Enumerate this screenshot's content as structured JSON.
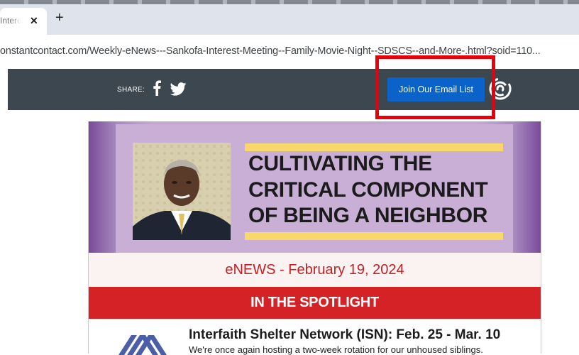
{
  "browser": {
    "tab_title": "Interes",
    "tab_close": "✕",
    "new_tab": "+",
    "url": "onstantcontact.com/Weekly-eNews---Sankofa-Interest-Meeting--Family-Movie-Night--SDSCS--and-More-.html?soid=110..."
  },
  "share_bar": {
    "share_label": "SHARE:",
    "icons": [
      "facebook-icon",
      "twitter-icon"
    ],
    "join_button_label": "Join Our Email List",
    "logo": "constant-contact-logo",
    "colors": {
      "bar": "#3d4750",
      "button": "#0b63c9",
      "highlight": "#e8000b"
    }
  },
  "newsletter": {
    "hero": {
      "line1": "CULTIVATING THE",
      "line2": "CRITICAL COMPONENT",
      "line3": "OF BEING A NEIGHBOR"
    },
    "enews_date": "eNEWS - February 19, 2024",
    "spotlight": "IN THE SPOTLIGHT",
    "item": {
      "title": "Interfaith Shelter Network (ISN): Feb. 25 - Mar. 10",
      "description": "We're once again hosting a two-week rotation for our unhoused siblings."
    },
    "colors": {
      "accent": "#d52226",
      "hero_bg": "#c3a7cf",
      "stripe": "#f9d86b"
    }
  }
}
